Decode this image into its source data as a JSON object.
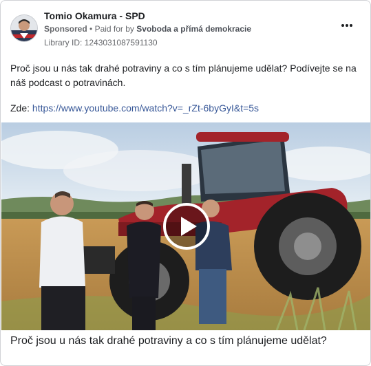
{
  "ad": {
    "page_name": "Tomio Okamura - SPD",
    "sponsored": "Sponsored",
    "paid_for_prefix": "Paid for by",
    "payer": "Svoboda a přímá demokracie",
    "separator": "•",
    "library_id": "Library ID: 1243031087591130",
    "body_text": "Proč jsou u nás tak drahé potraviny a co s tím plánujeme udělat? Podívejte se na náš podcast o potravinách.",
    "link_prefix": "Zde:",
    "link_url": "https://www.youtube.com/watch?v=_rZt-6byGyI&t=5s",
    "caption": "Proč jsou u nás tak drahé potraviny a co s tím plánujeme udělat?"
  },
  "icons": {
    "more": "more-options-icon",
    "play": "play-icon",
    "avatar": "page-avatar"
  },
  "colors": {
    "link": "#385898",
    "tractor": "#a3232a",
    "text": "#1c1e21",
    "meta": "#65676b"
  }
}
